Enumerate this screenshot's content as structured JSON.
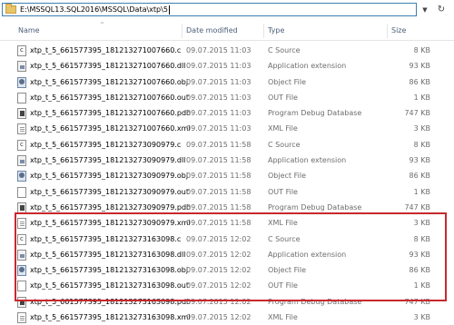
{
  "address_bar": {
    "path": "E:\\MSSQL13.SQL2016\\MSSQL\\Data\\xtp\\5"
  },
  "columns": {
    "name": "Name",
    "date_modified": "Date modified",
    "type": "Type",
    "size": "Size"
  },
  "files": [
    {
      "name": "xtp_t_5_661577395_181213271007660.c",
      "date": "09.07.2015 11:03",
      "type": "C Source",
      "size": "8 KB",
      "icon": "c"
    },
    {
      "name": "xtp_t_5_661577395_181213271007660.dll",
      "date": "09.07.2015 11:03",
      "type": "Application extension",
      "size": "93 KB",
      "icon": "dll"
    },
    {
      "name": "xtp_t_5_661577395_181213271007660.obj",
      "date": "09.07.2015 11:03",
      "type": "Object File",
      "size": "86 KB",
      "icon": "obj"
    },
    {
      "name": "xtp_t_5_661577395_181213271007660.out",
      "date": "09.07.2015 11:03",
      "type": "OUT File",
      "size": "1 KB",
      "icon": "out"
    },
    {
      "name": "xtp_t_5_661577395_181213271007660.pdb",
      "date": "09.07.2015 11:03",
      "type": "Program Debug Database",
      "size": "747 KB",
      "icon": "pdb"
    },
    {
      "name": "xtp_t_5_661577395_181213271007660.xml",
      "date": "09.07.2015 11:03",
      "type": "XML File",
      "size": "3 KB",
      "icon": "xml"
    },
    {
      "name": "xtp_t_5_661577395_181213273090979.c",
      "date": "09.07.2015 11:58",
      "type": "C Source",
      "size": "8 KB",
      "icon": "c"
    },
    {
      "name": "xtp_t_5_661577395_181213273090979.dll",
      "date": "09.07.2015 11:58",
      "type": "Application extension",
      "size": "93 KB",
      "icon": "dll"
    },
    {
      "name": "xtp_t_5_661577395_181213273090979.obj",
      "date": "09.07.2015 11:58",
      "type": "Object File",
      "size": "86 KB",
      "icon": "obj"
    },
    {
      "name": "xtp_t_5_661577395_181213273090979.out",
      "date": "09.07.2015 11:58",
      "type": "OUT File",
      "size": "1 KB",
      "icon": "out"
    },
    {
      "name": "xtp_t_5_661577395_181213273090979.pdb",
      "date": "09.07.2015 11:58",
      "type": "Program Debug Database",
      "size": "747 KB",
      "icon": "pdb"
    },
    {
      "name": "xtp_t_5_661577395_181213273090979.xml",
      "date": "09.07.2015 11:58",
      "type": "XML File",
      "size": "3 KB",
      "icon": "xml"
    },
    {
      "name": "xtp_t_5_661577395_181213273163098.c",
      "date": "09.07.2015 12:02",
      "type": "C Source",
      "size": "8 KB",
      "icon": "c"
    },
    {
      "name": "xtp_t_5_661577395_181213273163098.dll",
      "date": "09.07.2015 12:02",
      "type": "Application extension",
      "size": "93 KB",
      "icon": "dll"
    },
    {
      "name": "xtp_t_5_661577395_181213273163098.obj",
      "date": "09.07.2015 12:02",
      "type": "Object File",
      "size": "86 KB",
      "icon": "obj"
    },
    {
      "name": "xtp_t_5_661577395_181213273163098.out",
      "date": "09.07.2015 12:02",
      "type": "OUT File",
      "size": "1 KB",
      "icon": "out"
    },
    {
      "name": "xtp_t_5_661577395_181213273163098.pdb",
      "date": "09.07.2015 12:02",
      "type": "Program Debug Database",
      "size": "747 KB",
      "icon": "pdb"
    },
    {
      "name": "xtp_t_5_661577395_181213273163098.xml",
      "date": "09.07.2015 12:02",
      "type": "XML File",
      "size": "3 KB",
      "icon": "xml"
    }
  ],
  "icons": {
    "dropdown": "chevron-down-icon",
    "refresh": "refresh-icon",
    "folder": "folder-icon"
  },
  "colors": {
    "highlight_border": "#c8282e",
    "address_border": "#3c7fb1",
    "header_text": "#4c607a"
  }
}
